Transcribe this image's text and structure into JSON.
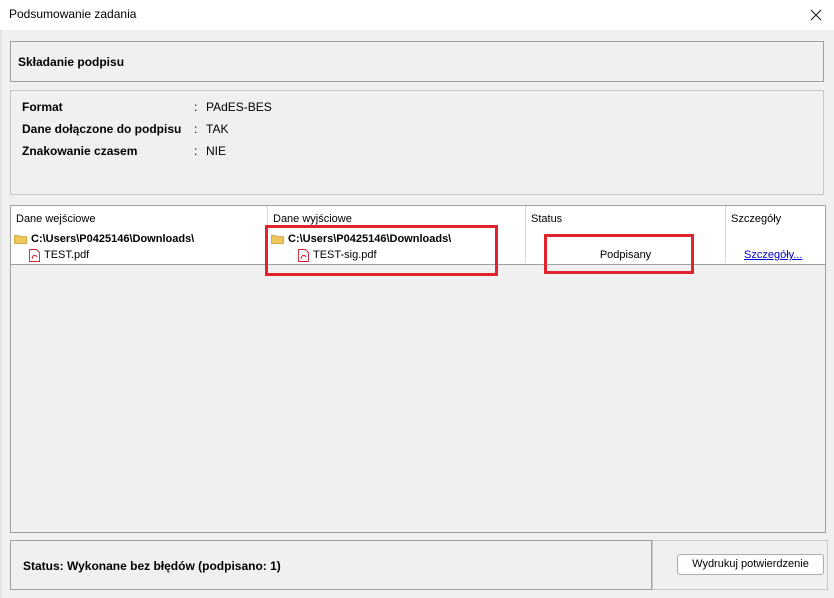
{
  "window": {
    "title": "Podsumowanie zadania",
    "close_icon": "close-icon"
  },
  "header": {
    "title": "Składanie podpisu"
  },
  "properties": [
    {
      "label": "Format",
      "separator": ":",
      "value": "PAdES-BES"
    },
    {
      "label": "Dane dołączone do podpisu",
      "separator": ":",
      "value": "TAK"
    },
    {
      "label": "Znakowanie czasem",
      "separator": ":",
      "value": "NIE"
    }
  ],
  "table": {
    "columns": [
      "Dane wejściowe",
      "Dane wyjściowe",
      "Status",
      "Szczegóły"
    ],
    "rows": [
      {
        "input": "C:\\Users\\P0425146\\Downloads\\",
        "output": "C:\\Users\\P0425146\\Downloads\\",
        "status": "",
        "details": "",
        "type": "folder"
      },
      {
        "input": "TEST.pdf",
        "output": "TEST-sig.pdf",
        "status": "Podpisany",
        "details": "Szczegóły...",
        "type": "pdf"
      }
    ]
  },
  "footer": {
    "status": "Status: Wykonane bez błędów (podpisano: 1)",
    "print_button": "Wydrukuj potwierdzenie"
  },
  "colors": {
    "highlight": "#e0232d",
    "link": "#0000cc",
    "pdf_icon": "#d0202a",
    "folder_icon": "#e8c048"
  }
}
